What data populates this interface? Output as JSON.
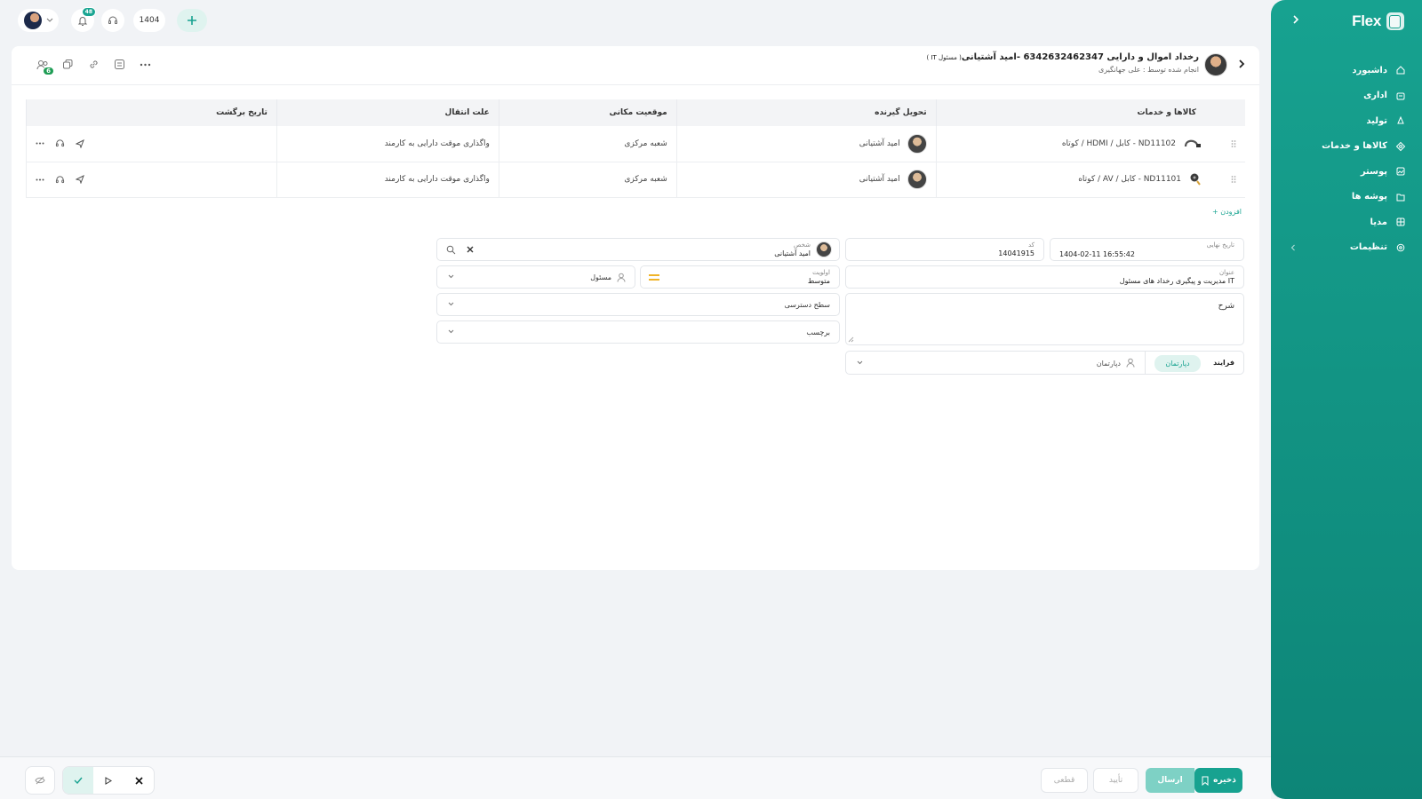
{
  "sidebar": {
    "brand": "Flex",
    "items": [
      {
        "label": "داشبورد",
        "icon": "home-icon"
      },
      {
        "label": "اداری",
        "icon": "office-icon"
      },
      {
        "label": "تولید",
        "icon": "production-icon"
      },
      {
        "label": "کالاها و خدمات",
        "icon": "goods-icon"
      },
      {
        "label": "پوستر",
        "icon": "poster-icon"
      },
      {
        "label": "پوشه ها",
        "icon": "folder-icon"
      },
      {
        "label": "مدیا",
        "icon": "media-icon"
      },
      {
        "label": "تنظیمات",
        "icon": "settings-icon"
      }
    ]
  },
  "topbar": {
    "notifications_count": "48",
    "year": "1404"
  },
  "header": {
    "title": "رخداد اموال و دارایی 6342632462347 -امید آشتیانی",
    "title_suffix": "( مسئول IT )",
    "subtitle": "انجام شده توسط : علی جهانگیری",
    "followers_count": "6"
  },
  "table": {
    "columns": [
      "کالاها و خدمات",
      "تحویل گیرنده",
      "موقعیت مکانی",
      "علت انتقال",
      "تاریخ برگشت"
    ],
    "rows": [
      {
        "item": "ND11102 - کابل / HDMI / کوتاه",
        "receiver": "امید آشتیانی",
        "location": "شعبه مرکزی",
        "reason": "واگذاری موقت دارایی به کارمند",
        "return_date": ""
      },
      {
        "item": "ND11101 - کابل / AV / کوتاه",
        "receiver": "امید آشتیانی",
        "location": "شعبه مرکزی",
        "reason": "واگذاری موقت دارایی به کارمند",
        "return_date": ""
      }
    ],
    "add_label": "افزودن"
  },
  "form": {
    "deadline_label": "تاریخ نهایی",
    "deadline_value": "1404-02-11 16:55:42",
    "code_label": "کد",
    "code_value": "14041915",
    "person_label": "شخص",
    "person_value": "امید آشتیانی",
    "title_label": "عنوان",
    "title_value": "مدیریت و پیگیری رخداد های مسئول IT",
    "priority_label": "اولویت",
    "priority_value": "متوسط",
    "responsible_placeholder": "مسئول",
    "access_level_placeholder": "سطح دسترسی",
    "tag_placeholder": "برچسب",
    "description_placeholder": "شرح",
    "process_tab": "فرایند",
    "department_tab": "دپارتمان",
    "department_placeholder": "دپارتمان"
  },
  "footer": {
    "save_label": "ذخیره",
    "send_label": "ارسال",
    "approve_label": "تأیید",
    "final_label": "قطعی"
  },
  "colors": {
    "accent": "#17a290",
    "priority": "#f0b429"
  }
}
